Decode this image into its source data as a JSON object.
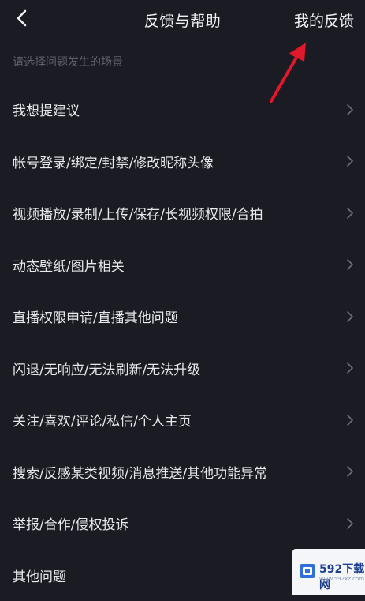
{
  "header": {
    "title": "反馈与帮助",
    "right_action": "我的反馈",
    "back_icon": "chevron-left-icon"
  },
  "section": {
    "hint": "请选择问题发生的场景"
  },
  "items": [
    {
      "label": "我想提建议"
    },
    {
      "label": "帐号登录/绑定/封禁/修改昵称头像"
    },
    {
      "label": "视频播放/录制/上传/保存/长视频权限/合拍"
    },
    {
      "label": "动态壁纸/图片相关"
    },
    {
      "label": "直播权限申请/直播其他问题"
    },
    {
      "label": "闪退/无响应/无法刷新/无法升级"
    },
    {
      "label": "关注/喜欢/评论/私信/个人主页"
    },
    {
      "label": "搜索/反感某类视频/消息推送/其他功能异常"
    },
    {
      "label": "举报/合作/侵权投诉"
    },
    {
      "label": "其他问题"
    }
  ],
  "watermark": {
    "text": "592下载网",
    "sub": "www.592xz.com"
  },
  "colors": {
    "background": "#1a1b23",
    "text": "#e7e8ec",
    "hint": "#5f616b",
    "chevron": "#6b6d76",
    "annotation_arrow": "#e0182b"
  }
}
